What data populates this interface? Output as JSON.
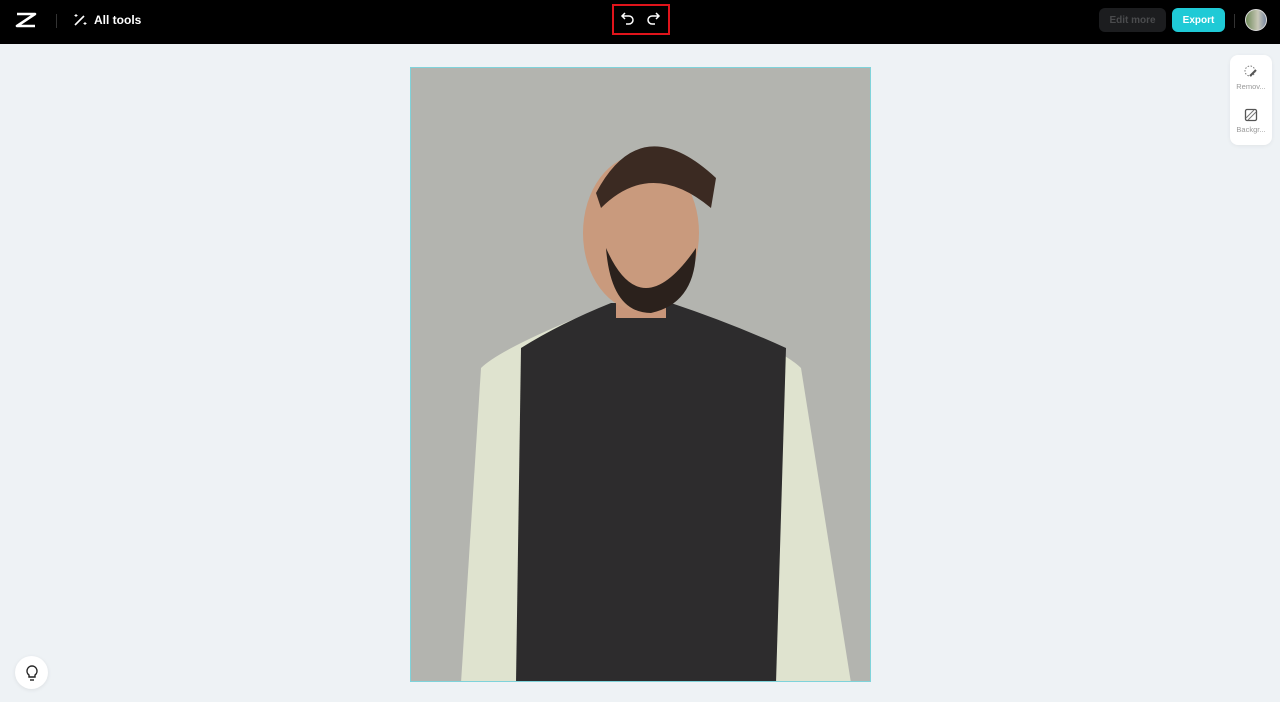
{
  "header": {
    "all_tools_label": "All tools",
    "edit_more_label": "Edit more",
    "export_label": "Export",
    "accent_color": "#1fcad6"
  },
  "side_tools": [
    {
      "label": "Remov...",
      "icon": "eraser-icon"
    },
    {
      "label": "Backgr...",
      "icon": "background-icon"
    }
  ],
  "canvas": {
    "background_color": "#b3b4af",
    "content": "portrait photo"
  }
}
